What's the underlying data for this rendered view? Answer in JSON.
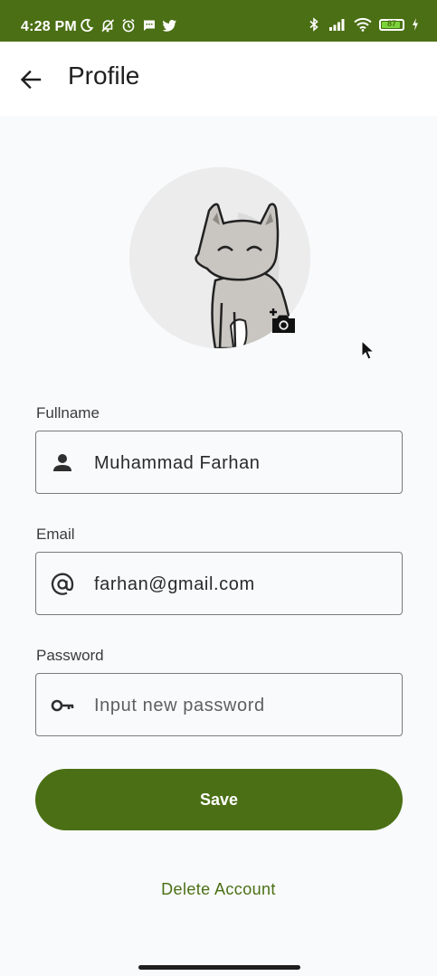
{
  "status_bar": {
    "time": "4:28 PM",
    "battery": "87",
    "left_icons": [
      "moon-icon",
      "notifications-off-icon",
      "alarm-icon",
      "message-icon",
      "twitter-icon"
    ],
    "right_icons": [
      "bluetooth-icon",
      "signal-icon",
      "wifi-icon",
      "battery-icon",
      "charging-icon"
    ],
    "background_color": "#4b6f14"
  },
  "app_bar": {
    "back_icon": "arrow-left-icon",
    "title": "Profile"
  },
  "profile": {
    "avatar": "cat-avatar-image",
    "change_photo_icon": "add-photo-camera-icon"
  },
  "form": {
    "fullname": {
      "label": "Fullname",
      "icon": "person-icon",
      "value": "Muhammad Farhan"
    },
    "email": {
      "label": "Email",
      "icon": "at-sign-icon",
      "value": "farhan@gmail.com"
    },
    "password": {
      "label": "Password",
      "icon": "key-icon",
      "value": "",
      "placeholder": "Input new password"
    }
  },
  "actions": {
    "save_label": "Save",
    "delete_label": "Delete Account"
  },
  "colors": {
    "primary": "#4b6f14",
    "background": "#f8fafc",
    "text": "#1f1f1f"
  }
}
